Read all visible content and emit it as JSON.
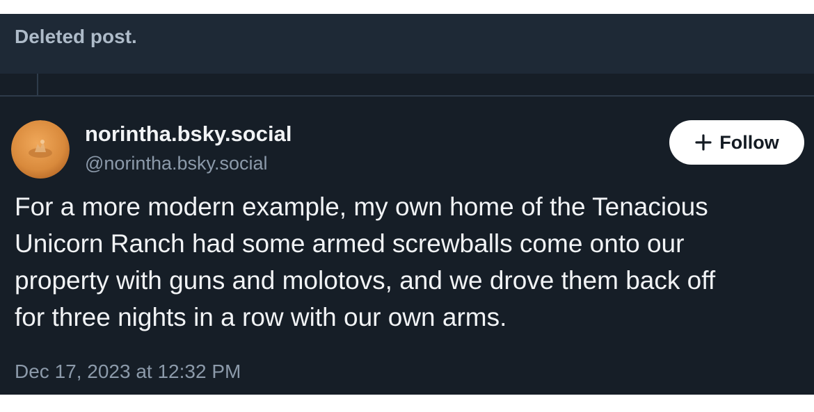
{
  "deleted_post": {
    "text": "Deleted post."
  },
  "post": {
    "author": {
      "display_name": "norintha.bsky.social",
      "handle": "@norintha.bsky.social",
      "avatar_icon": "avatar-image"
    },
    "follow_button": {
      "label": "Follow",
      "icon": "plus-icon"
    },
    "text_lines": [
      "For a more modern example, my own home of the Tenacious",
      "Unicorn Ranch had some armed screwballs come onto our",
      "property with guns and molotovs, and we drove them back off",
      "for three nights in a row with our own arms."
    ],
    "timestamp": "Dec 17, 2023 at 12:32 PM"
  },
  "colors": {
    "background": "#161e27",
    "deleted_background": "#1e2936",
    "primary_text": "#f1f3f5",
    "secondary_text": "#8c9aaa",
    "button_background": "#ffffff"
  }
}
